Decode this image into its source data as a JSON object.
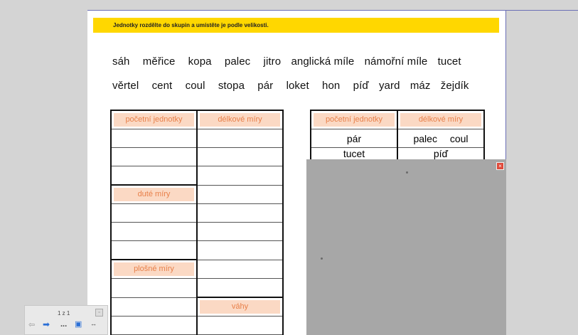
{
  "banner": {
    "text": "Jednotky rozdělte do skupin a umístěte je podle velikosti."
  },
  "words": {
    "line1": [
      "sáh",
      "měřice",
      "kopa",
      "palec",
      "jitro",
      "anglická míle",
      "námořní míle",
      "tucet"
    ],
    "line2": [
      "věrtel",
      "cent",
      "coul",
      "stopa",
      "pár",
      "loket",
      "hon",
      "píď",
      "yard",
      "máz",
      "žejdík"
    ]
  },
  "left_table": {
    "col1_header": "početní jednotky",
    "col2_header": "délkové míry",
    "dute": "duté míry",
    "plosne": "plošné míry",
    "vahy": "váhy"
  },
  "right_table": {
    "col1_header": "početní jednotky",
    "col2_header": "délkové míry",
    "row1_col1": "pár",
    "row1_col2a": "palec",
    "row1_col2b": "coul",
    "row2_col1": "tucet",
    "row2_col2": "píď"
  },
  "popup": {
    "close_label": "×"
  },
  "toolbar": {
    "page_indicator": "1 z 1",
    "back_label": "⇦",
    "forward_label": "➡",
    "more_label": "...",
    "screen_label": "▣",
    "resize_label": "↔",
    "close_label": "▫"
  }
}
